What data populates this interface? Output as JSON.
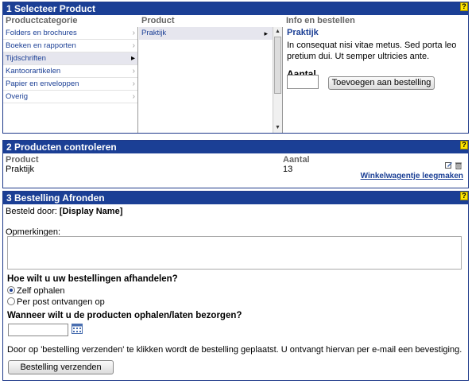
{
  "section1": {
    "title": "1 Selecteer Product",
    "col_category": "Productcategorie",
    "col_product": "Product",
    "col_info": "Info en bestellen",
    "categories": [
      {
        "label": "Folders en brochures"
      },
      {
        "label": "Boeken en rapporten"
      },
      {
        "label": "Tijdschriften"
      },
      {
        "label": "Kantoorartikelen"
      },
      {
        "label": "Papier en enveloppen"
      },
      {
        "label": "Overig"
      }
    ],
    "products": [
      {
        "label": "Praktijk"
      }
    ],
    "info": {
      "title": "Praktijk",
      "description": "In consequat nisi vitae metus. Sed porta leo pretium dui. Ut semper ultricies ante.",
      "quantity_label": "Aantal",
      "quantity_value": "",
      "add_button": "Toevoegen aan bestelling"
    },
    "help": "?"
  },
  "section2": {
    "title": "2 Producten controleren",
    "col_product": "Product",
    "col_quantity": "Aantal",
    "row": {
      "product": "Praktijk",
      "quantity": "13"
    },
    "empty_cart_link": "Winkelwagentje leegmaken",
    "help": "?"
  },
  "section3": {
    "title": "3 Bestelling Afronden",
    "ordered_by_label": "Besteld door:",
    "ordered_by_value": "[Display Name]",
    "remarks_label": "Opmerkingen:",
    "remarks_value": "",
    "handling_question": "Hoe wilt u uw bestellingen afhandelen?",
    "options": [
      {
        "label": "Zelf ophalen",
        "selected": true
      },
      {
        "label": "Per post ontvangen op",
        "selected": false
      }
    ],
    "date_question": "Wanneer wilt u de producten ophalen/laten bezorgen?",
    "date_value": "",
    "notice": "Door op 'bestelling verzenden' te klikken wordt de bestelling geplaatst. U ontvangt hiervan per e-mail een bevestiging.",
    "send_button": "Bestelling verzenden",
    "help": "?"
  }
}
